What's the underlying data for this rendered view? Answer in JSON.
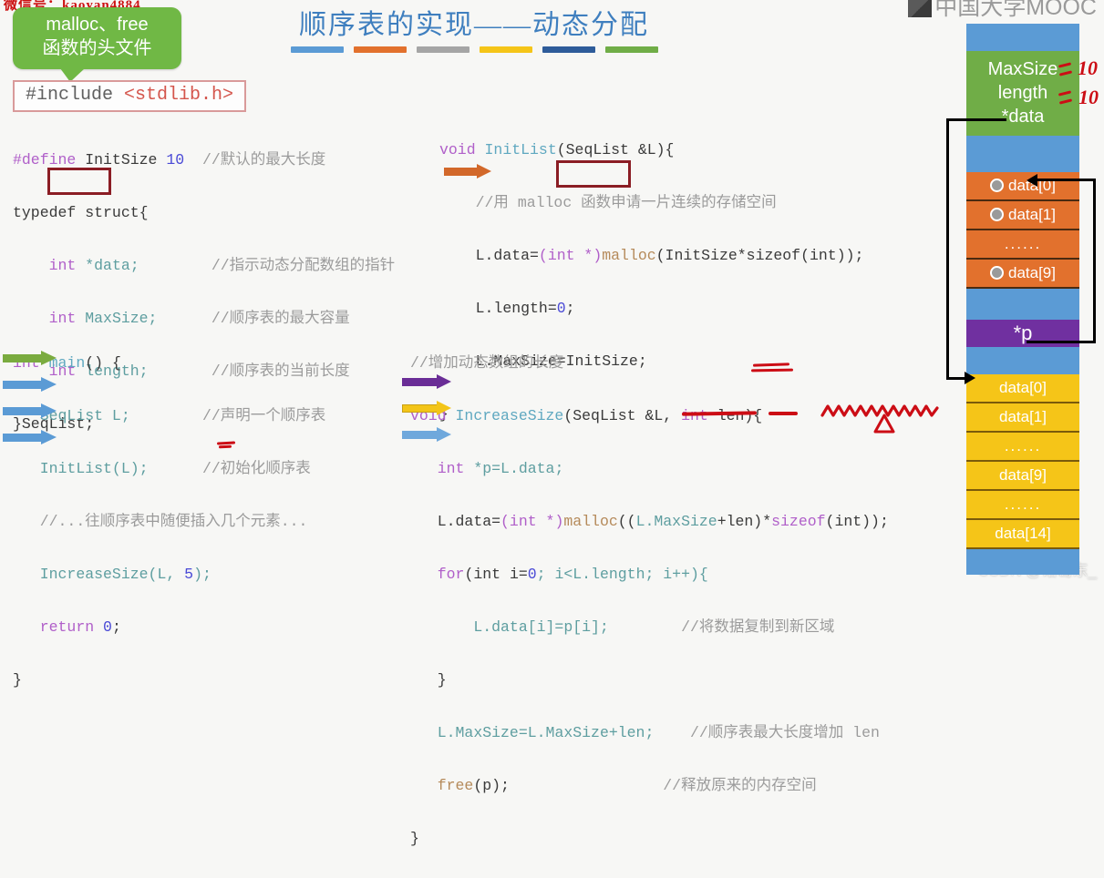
{
  "watermarks": {
    "left": "微信号：kaoyan4884",
    "logo": "中国大学MOOC",
    "csdn": "CSDN @诸葛东_"
  },
  "slide": {
    "title": "顺序表的实现——动态分配",
    "rule_colors": [
      "#5b9bd5",
      "#e2712d",
      "#a5a5a5",
      "#f5c518",
      "#2e5c9a",
      "#70ad47"
    ]
  },
  "callout": {
    "line1": "malloc、free",
    "line2": "函数的头文件",
    "color": "#70b845"
  },
  "include": {
    "directive": "#include",
    "header": "<stdlib.h>"
  },
  "code_struct": {
    "lines": [
      "#define InitSize 10   //默认的最大长度",
      "typedef struct{",
      "    int *data;          //指示动态分配数组的指针",
      "    int MaxSize;        //顺序表的最大容量",
      "    int length;         //顺序表的当前长度",
      "}SeqList;"
    ],
    "l1_define": "#define",
    "l1_name": "InitSize",
    "l1_num": "10",
    "l1_cmt": "//默认的最大长度",
    "l2": "typedef struct{",
    "l3_type": "int",
    "l3_var": "*data;",
    "l3_cmt": "//指示动态分配数组的指针",
    "l4_type": "int",
    "l4_var": "MaxSize;",
    "l4_cmt": "//顺序表的最大容量",
    "l5_type": "int",
    "l5_var": "length;",
    "l5_cmt": "//顺序表的当前长度",
    "l6": "}SeqList;"
  },
  "code_initlist": {
    "l1_kw": "void",
    "l1_fn": "InitList",
    "l1_rest": "(SeqList &L){",
    "l2_cmt": "//用 malloc 函数申请一片连续的存储空间",
    "l3_a": "L.data=",
    "l3_cast": "(int *)",
    "l3_fn": "malloc",
    "l3_rest": "(InitSize*sizeof(int));",
    "l4_a": "L.length=",
    "l4_num": "0",
    "l4_semi": ";",
    "l5": "L.MaxSize=InitSize;",
    "l6": "}"
  },
  "code_main": {
    "l1_kw": "int",
    "l1_fn": "main",
    "l1_rest": "() {",
    "l2_code": "SeqList L;",
    "l2_cmt": "//声明一个顺序表",
    "l3_code": "InitList(L);",
    "l3_cmt": "//初始化顺序表",
    "l4_cmt": "//...往顺序表中随便插入几个元素...",
    "l5_code_a": "IncreaseSize(L, ",
    "l5_num": "5",
    "l5_code_b": ");",
    "l6_kw": "return",
    "l6_num": "0",
    "l6_semi": ";",
    "l7": "}"
  },
  "code_increase": {
    "l0_cmt": "//增加动态数组的长度",
    "l1_kw": "void",
    "l1_fn": "IncreaseSize",
    "l1_mid": "(SeqList &L, ",
    "l1_type": "int",
    "l1_arg": " len){",
    "l2_type": "int",
    "l2_rest": " *p=L.data;",
    "l3": "L.data=(int *)malloc((L.MaxSize+len)*sizeof(int));",
    "l3_a": "L.data=",
    "l3_cast": "(int *)",
    "l3_fn": "malloc",
    "l3_b": "((",
    "l3_maxsize": "L.MaxSize",
    "l3_c": "+len)*",
    "l3_sizeof": "sizeof",
    "l3_d": "(int));",
    "l4_kw": "for",
    "l4_a": "(int i=",
    "l4_num0": "0",
    "l4_b": "; i<L.length; i++){",
    "l5_code": "L.data[i]=p[i];",
    "l5_cmt": "//将数据复制到新区域",
    "l6": "}",
    "l7_code": "L.MaxSize=L.MaxSize+len;",
    "l7_cmt": "//顺序表最大长度增加 len",
    "l8_fn": "free",
    "l8_rest": "(p);",
    "l8_cmt": "//释放原来的内存空间",
    "l9": "}"
  },
  "arrows": {
    "main": [
      {
        "color": "#70ad47",
        "name": "arrow-seqlist-decl"
      },
      {
        "color": "#5b9bd5",
        "name": "arrow-initlist-call"
      },
      {
        "color": "#5b9bd5",
        "name": "arrow-insert-comment"
      },
      {
        "color": "#5b9bd5",
        "name": "arrow-increasesize-call"
      }
    ],
    "initlist": [
      {
        "color": "#e2712d",
        "name": "arrow-malloc-line"
      }
    ],
    "increase": [
      {
        "color": "#7030a0",
        "name": "arrow-pointer-save"
      },
      {
        "color": "#f5c518",
        "name": "arrow-new-malloc"
      },
      {
        "color": "#5b9bd5",
        "name": "arrow-copy-loop"
      }
    ]
  },
  "memory": {
    "fields": {
      "maxsize_label": "MaxSize",
      "length_label": "length",
      "data_label": "*data",
      "maxsize_value": "10",
      "length_value": "10"
    },
    "pointer_label": "*p",
    "old_block": {
      "color": "#e2712d",
      "cells": [
        "data[0]",
        "data[1]",
        "......",
        "data[9]"
      ]
    },
    "new_block": {
      "color": "#f5c518",
      "cells": [
        "data[0]",
        "data[1]",
        "......",
        "data[9]",
        "......",
        "data[14]"
      ]
    }
  }
}
